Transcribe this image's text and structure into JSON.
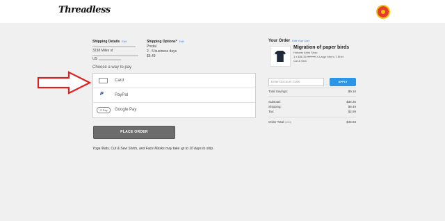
{
  "header": {
    "logo_text": "Threadless"
  },
  "shipping_details": {
    "title": "Shipping Details",
    "edit": "Edit",
    "name_line": "3238 Miles st",
    "country_line": "US"
  },
  "shipping_options": {
    "title": "Shipping Options*",
    "edit": "Edit",
    "method": "Postal",
    "eta": "2 - 5 business days",
    "price": "$6.49"
  },
  "payment": {
    "choose_label": "Choose a way to pay",
    "methods": [
      {
        "label": "Card",
        "icon": "credit-card-icon"
      },
      {
        "label": "PayPal",
        "icon": "paypal-icon",
        "glyph": "P"
      },
      {
        "label": "Google Pay",
        "icon": "google-pay-icon",
        "glyph": "G Pay"
      }
    ]
  },
  "place_order": {
    "label": "PLACE ORDER"
  },
  "shipping_note": "Yoga Mats, Cut & Sew Shirts, and Face Masks may take up to 10 days to ship.",
  "order": {
    "title": "Your Order",
    "edit": "Edit Your Cart",
    "product": {
      "title": "Migration of paper birds",
      "artist": "Hobarts Artist Shop",
      "line_qty": "1 x",
      "line_price": "$36.35",
      "line_old_price": "$45.45",
      "line_desc": "X-Large Men's T-Shirt",
      "line_type": "Cut & Sew"
    },
    "discount_placeholder": "Enter Discount Code",
    "apply_label": "APPLY",
    "total_savings": {
      "label": "Total Savings:",
      "value": "$9.10"
    },
    "subtotal": {
      "label": "Subtotal:",
      "value": "$36.35"
    },
    "shipping": {
      "label": "Shipping:",
      "value": "$6.49"
    },
    "tax": {
      "label": "Tax:",
      "value": "$2.99"
    },
    "order_total": {
      "label": "Order Total",
      "currency": "(USD)",
      "value": "$45.83"
    }
  },
  "colors": {
    "accent": "#2b96e8",
    "button": "#6c6c6c",
    "arrow": "#e02020"
  }
}
